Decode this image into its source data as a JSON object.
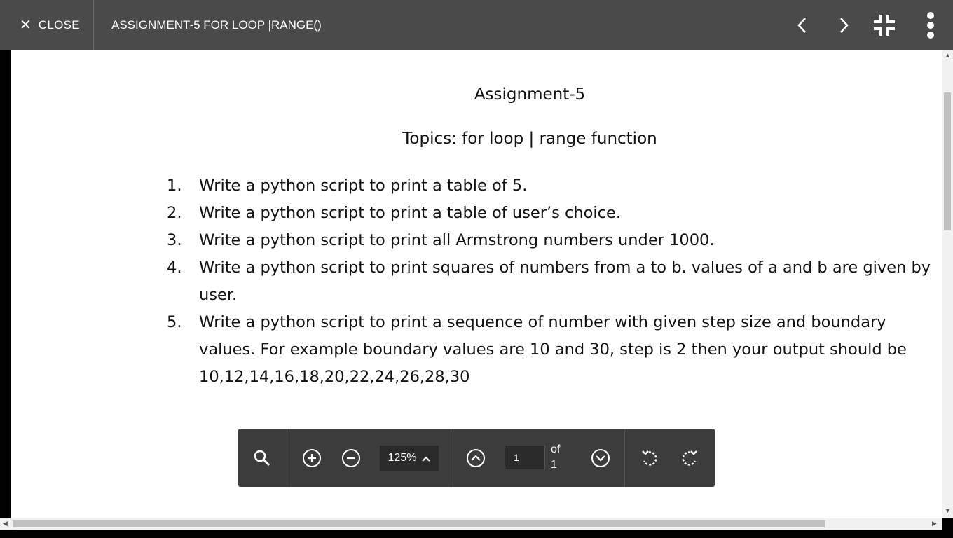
{
  "topbar": {
    "close_label": "CLOSE",
    "title": "ASSIGNMENT-5 FOR LOOP |RANGE()"
  },
  "document": {
    "heading": "Assignment-5",
    "topics": "Topics: for loop | range function",
    "questions": [
      {
        "num": "1.",
        "lines": [
          "Write a python script to print a table of 5."
        ]
      },
      {
        "num": "2.",
        "lines": [
          "Write a python script to print a table of user’s choice."
        ]
      },
      {
        "num": "3.",
        "lines": [
          "Write a python script to print all Armstrong numbers under 1000."
        ]
      },
      {
        "num": "4.",
        "lines": [
          "Write a python script to print squares of numbers from a to b. values of a and b are given by",
          "user."
        ]
      },
      {
        "num": "5.",
        "lines": [
          "Write a python script to print a sequence of number with given step size and boundary",
          "values. For example boundary values are 10 and 30, step is 2 then your output should be",
          "10,12,14,16,18,20,22,24,26,28,30"
        ]
      }
    ]
  },
  "toolbar": {
    "zoom": "125%",
    "page_current": "1",
    "page_of": "of",
    "page_total": "1"
  },
  "icons": {
    "close": "close-icon",
    "prev": "chevron-left-icon",
    "next": "chevron-right-icon",
    "exit_fullscreen": "exit-fullscreen-icon",
    "more": "more-vertical-icon",
    "search": "search-icon",
    "zoom_in": "zoom-in-icon",
    "zoom_out": "zoom-out-icon",
    "page_up": "page-up-icon",
    "page_down": "page-down-icon",
    "rotate_left": "rotate-counterclockwise-icon",
    "rotate_right": "rotate-clockwise-icon"
  }
}
